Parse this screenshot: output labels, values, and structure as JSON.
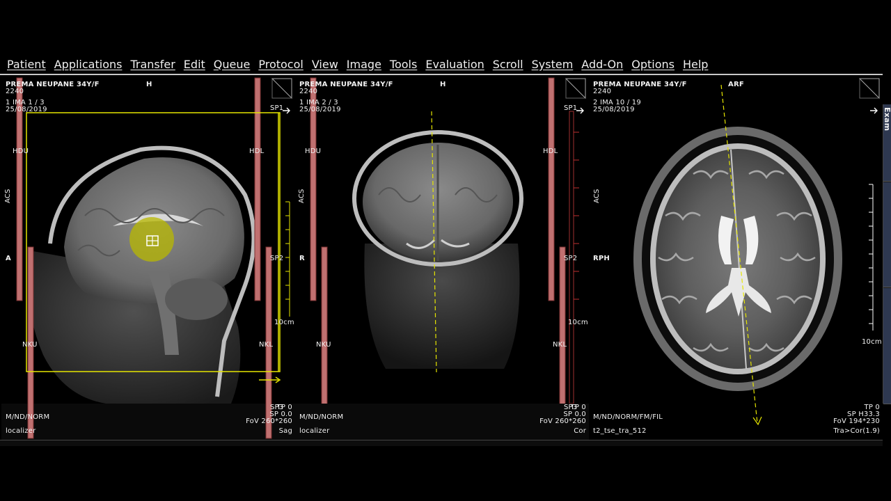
{
  "menu": [
    "Patient",
    "Applications",
    "Transfer",
    "Edit",
    "Queue",
    "Protocol",
    "View",
    "Image",
    "Tools",
    "Evaluation",
    "Scroll",
    "System",
    "Add-On",
    "Options",
    "Help"
  ],
  "colors": {
    "accent_yellow": "#e6e600",
    "active_border": "#2a4bff",
    "slab_red": "#c07070"
  },
  "viewports": [
    {
      "patient": "PREMA NEUPANE 34Y/F",
      "orient_top": "H",
      "id": "2240",
      "series": "1 IMA 1 / 3",
      "date": "25/08/2019",
      "left_label": "A",
      "side_label": "ACS",
      "slab_top_left": "HDU",
      "slab_top_right": "HDL",
      "slab_bottom_left": "NKU",
      "slab_bottom_right": "NKL",
      "sp1": "SP1",
      "sp2": "SP2",
      "sp3": "SP3",
      "scale": "10cm",
      "window": "M/ND/NORM",
      "protocol": "localizer",
      "tp": "TP 0",
      "sp": "SP  0.0",
      "fov": "FoV 260*260",
      "plane": "Sag",
      "icon": "move-cursor-icon"
    },
    {
      "patient": "PREMA NEUPANE 34Y/F",
      "orient_top": "H",
      "id": "2240",
      "series": "1 IMA 2 / 3",
      "date": "25/08/2019",
      "left_label": "R",
      "side_label": "ACS",
      "slab_top_left": "HDU",
      "slab_top_right": "HDL",
      "slab_bottom_left": "NKU",
      "slab_bottom_right": "NKL",
      "sp1": "SP1",
      "sp2": "SP2",
      "sp3": "SP3",
      "scale": "10cm",
      "window": "M/ND/NORM",
      "protocol": "localizer",
      "tp": "TP 0",
      "sp": "SP  0.0",
      "fov": "FoV 260*260",
      "plane": "Cor"
    },
    {
      "patient": "PREMA NEUPANE 34Y/F",
      "orient_top": "ARF",
      "id": "2240",
      "series": "2 IMA 10 / 19",
      "date": "25/08/2019",
      "left_label": "RPH",
      "side_label": "ACS",
      "scale": "10cm",
      "window": "M/ND/NORM/FM/FIL",
      "protocol": "t2_tse_tra_512",
      "tp": "TP 0",
      "sp": "SP H33.3",
      "fov": "FoV 194*230",
      "plane": "Tra>Cor(1.9)"
    }
  ],
  "side_tab_text": "Exam"
}
